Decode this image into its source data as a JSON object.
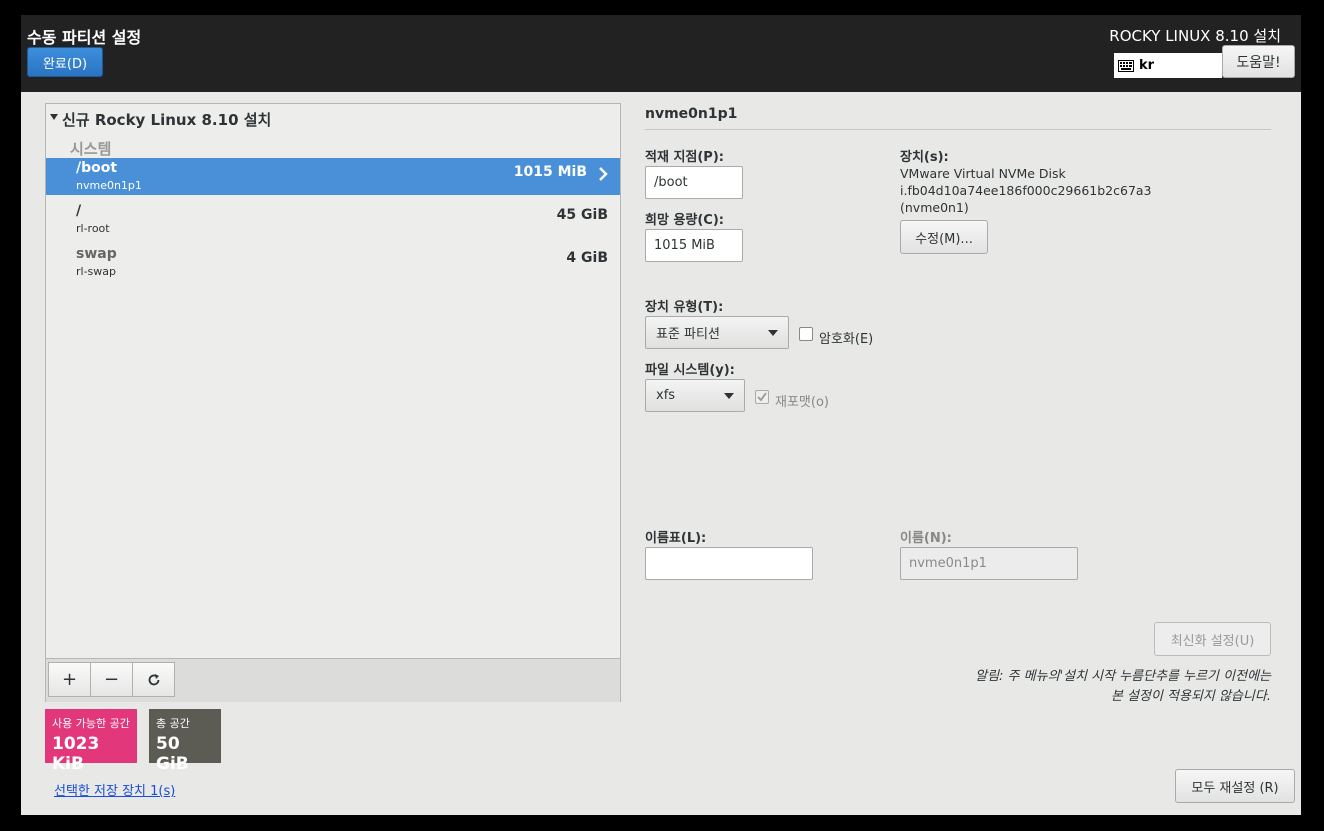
{
  "header": {
    "title": "수동 파티션 설정",
    "done_label": "완료(D)",
    "product": "ROCKY LINUX 8.10 설치",
    "keyboard_layout": "kr",
    "help_label": "도움말!"
  },
  "left": {
    "install_title": "신규 Rocky Linux 8.10 설치",
    "group_label": "시스템",
    "mounts": [
      {
        "name": "/boot",
        "device": "nvme0n1p1",
        "size": "1015 MiB",
        "selected": true
      },
      {
        "name": "/",
        "device": "rl-root",
        "size": "45 GiB",
        "selected": false
      },
      {
        "name": "swap",
        "device": "rl-swap",
        "size": "4 GiB",
        "selected": false
      }
    ],
    "toolbar": {
      "add": "+",
      "remove": "−"
    },
    "available": {
      "label": "사용 가능한 공간",
      "value": "1023 KiB"
    },
    "total": {
      "label": "총 공간",
      "value": "50 GiB"
    },
    "storage_link": "선택한 저장 장치 1(s)"
  },
  "right": {
    "title": "nvme0n1p1",
    "mount_point": {
      "label": "적재 지점(P):",
      "value": "/boot"
    },
    "desired_capacity": {
      "label": "희망 용량(C):",
      "value": "1015 MiB"
    },
    "devices": {
      "label": "장치(s):",
      "line1": "VMware Virtual NVMe Disk",
      "line2": "i.fb04d10a74ee186f000c29661b2c67a3",
      "line3": "(nvme0n1)",
      "modify_label": "수정(M)..."
    },
    "device_type": {
      "label": "장치 유형(T):",
      "value": "표준 파티션"
    },
    "encrypt": {
      "label": "암호화(E)",
      "checked": false
    },
    "filesystem": {
      "label": "파일 시스템(y):",
      "value": "xfs"
    },
    "reformat": {
      "label": "재포맷(o)",
      "checked": true
    },
    "label_field": {
      "label": "이름표(L):",
      "value": ""
    },
    "name_field": {
      "label": "이름(N):",
      "value": "nvme0n1p1"
    },
    "update_label": "최신화 설정(U)",
    "note_line1": "알림: 주 메뉴의'설치 시작 누름단추를 누르기 이전에는",
    "note_line2": "본 설정이 적용되지 않습니다.",
    "reset_all_label": "모두 재설정 (R)"
  }
}
